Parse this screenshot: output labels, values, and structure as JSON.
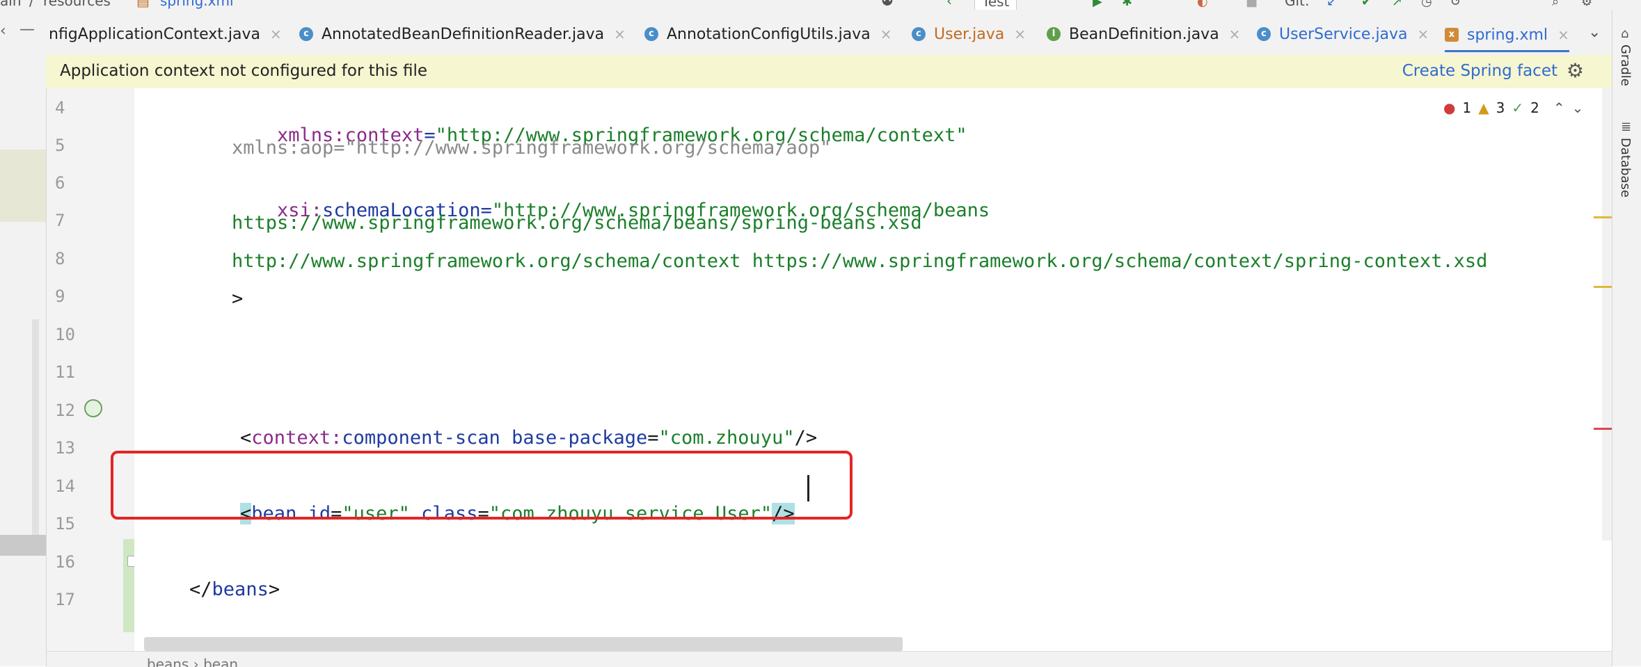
{
  "breadcrumb": {
    "part1": "ain",
    "sep": "/",
    "part2": "resources",
    "part3": "spring.xml"
  },
  "toolbar": {
    "run_config": "Test",
    "git_label": "Git:"
  },
  "tabs": [
    {
      "label": "nfigApplicationContext.java",
      "icon": ""
    },
    {
      "label": "AnnotatedBeanDefinitionReader.java",
      "icon": "class-icon"
    },
    {
      "label": "AnnotationConfigUtils.java",
      "icon": "class-icon"
    },
    {
      "label": "User.java",
      "icon": "class-icon"
    },
    {
      "label": "BeanDefinition.java",
      "icon": "interface-icon"
    },
    {
      "label": "UserService.java",
      "icon": "class-icon"
    },
    {
      "label": "spring.xml",
      "icon": "xml-file-icon"
    }
  ],
  "tab_close": "×",
  "banner": {
    "message": "Application context not configured for this file",
    "action": "Create Spring facet"
  },
  "inspections": {
    "errors": "1",
    "warnings": "3",
    "weak_warnings": "2"
  },
  "line_numbers": [
    "4",
    "5",
    "6",
    "7",
    "8",
    "9",
    "10",
    "11",
    "12",
    "13",
    "14",
    "15",
    "16",
    "17"
  ],
  "code": {
    "l4": {
      "ns": "xmlns:",
      "attr": "context",
      "eq": "=",
      "value": "\"http://www.springframework.org/schema/context\""
    },
    "l5": {
      "text": "xmlns:aop=\"http://www.springframework.org/schema/aop\""
    },
    "l6": {
      "ns": "xsi:",
      "attr": "schemaLocation",
      "eq": "=",
      "value": "\"http://www.springframework.org/schema/beans"
    },
    "l7": {
      "value": "https://www.springframework.org/schema/beans/spring-beans.xsd"
    },
    "l8": {
      "value": "http://www.springframework.org/schema/context https://www.springframework.org/schema/context/spring-context.xsd"
    },
    "l9": {
      "text": ">"
    },
    "l12": {
      "open": "<",
      "tag_ns": "context:",
      "tag": "component-scan",
      "attr": " base-package",
      "eq": "=",
      "value": "\"com.zhouyu\"",
      "close": "/>"
    },
    "l14": {
      "open": "<",
      "tag": "bean",
      "attr1": " id",
      "eq1": "=",
      "val1": "\"user\"",
      "attr2": " class",
      "eq2": "=",
      "val2": "\"com.zhouyu.service.User\"",
      "close": "/>"
    },
    "l16": {
      "open": "</",
      "tag": "beans",
      "close": ">"
    }
  },
  "side_tools": {
    "gradle": "Gradle",
    "database": "Database"
  },
  "bottom_breadcrumb": "beans › bean"
}
